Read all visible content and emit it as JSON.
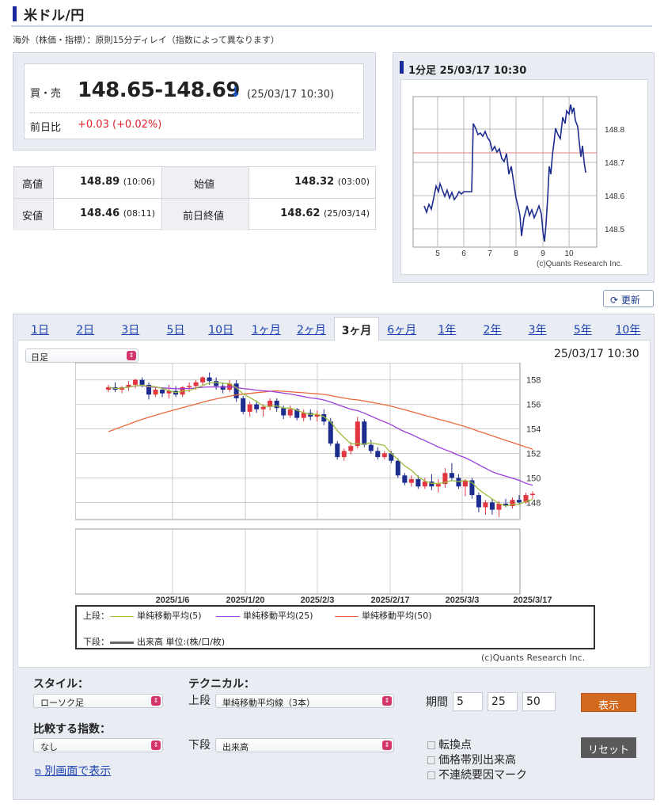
{
  "header": {
    "title": "米ドル/円",
    "note": "海外（株価・指標）：原則15分ディレイ（指数によって異なります）"
  },
  "quote": {
    "bid_ask_label": "買・売",
    "price": "148.65-148.69",
    "direction_arrow": "↓",
    "time": "(25/03/17 10:30)",
    "change_label": "前日比",
    "change": "+0.03 (+0.02%)",
    "change_color": "#e0202a"
  },
  "ohlc": {
    "high_label": "高値",
    "high_value": "148.89",
    "high_time": "(10:06)",
    "open_label": "始値",
    "open_value": "148.32",
    "open_time": "(03:00)",
    "low_label": "安値",
    "low_value": "148.46",
    "low_time": "(08:11)",
    "prev_label": "前日終値",
    "prev_value": "148.62",
    "prev_time": "(25/03/14)"
  },
  "minute_chart": {
    "title": "1分足 25/03/17 10:30",
    "credit": "(c)Quants Research Inc.",
    "x_ticks": [
      "5",
      "6",
      "7",
      "8",
      "9",
      "10"
    ],
    "y_ticks": [
      "148.8",
      "148.7",
      "148.6",
      "148.5"
    ],
    "reference_line": 148.72
  },
  "refresh_label": "更新",
  "tabs": [
    "1日",
    "2日",
    "3日",
    "5日",
    "10日",
    "1ヶ月",
    "2ヶ月",
    "3ヶ月",
    "6ヶ月",
    "1年",
    "2年",
    "3年",
    "5年",
    "10年"
  ],
  "active_tab": "3ヶ月",
  "chart_controls": {
    "period_select": "日足",
    "timestamp": "25/03/17 10:30"
  },
  "chart_data": {
    "type": "candlestick",
    "x_ticks": [
      "2025/1/6",
      "2025/1/20",
      "2025/2/3",
      "2025/2/17",
      "2025/3/3",
      "2025/3/17"
    ],
    "y_ticks": [
      "158",
      "156",
      "154",
      "152",
      "150",
      "148"
    ],
    "ylim": [
      146.6,
      159.4
    ],
    "candles": [
      [
        157.2,
        157.6,
        157.0,
        157.4
      ],
      [
        157.4,
        157.8,
        157.0,
        157.2
      ],
      [
        157.2,
        157.5,
        156.9,
        157.4
      ],
      [
        157.4,
        157.9,
        157.1,
        157.6
      ],
      [
        157.6,
        158.1,
        157.3,
        158.0
      ],
      [
        158.0,
        158.2,
        157.4,
        157.6
      ],
      [
        157.6,
        157.8,
        156.4,
        156.8
      ],
      [
        156.8,
        157.4,
        156.6,
        157.2
      ],
      [
        157.2,
        157.4,
        156.6,
        156.9
      ],
      [
        156.9,
        157.6,
        156.5,
        157.1
      ],
      [
        157.1,
        157.5,
        156.6,
        156.8
      ],
      [
        156.8,
        157.5,
        156.6,
        157.4
      ],
      [
        157.4,
        157.8,
        157.0,
        157.5
      ],
      [
        157.5,
        158.0,
        157.2,
        157.8
      ],
      [
        157.8,
        158.3,
        157.5,
        158.2
      ],
      [
        158.2,
        158.6,
        157.6,
        157.9
      ],
      [
        157.9,
        158.2,
        157.2,
        157.5
      ],
      [
        157.5,
        157.8,
        156.9,
        157.2
      ],
      [
        157.2,
        158.0,
        157.0,
        157.7
      ],
      [
        157.7,
        158.0,
        156.2,
        156.5
      ],
      [
        156.5,
        156.7,
        155.2,
        155.4
      ],
      [
        155.4,
        156.2,
        155.0,
        156.0
      ],
      [
        156.0,
        156.3,
        155.3,
        155.6
      ],
      [
        155.6,
        156.0,
        155.0,
        155.8
      ],
      [
        155.8,
        156.5,
        155.5,
        156.3
      ],
      [
        156.3,
        156.5,
        155.4,
        155.7
      ],
      [
        155.7,
        155.9,
        154.8,
        155.1
      ],
      [
        155.1,
        155.9,
        154.9,
        155.6
      ],
      [
        155.6,
        155.7,
        154.7,
        154.9
      ],
      [
        154.9,
        155.6,
        154.6,
        155.3
      ],
      [
        155.3,
        155.6,
        154.7,
        155.0
      ],
      [
        155.0,
        155.5,
        154.6,
        155.2
      ],
      [
        155.2,
        155.6,
        154.3,
        154.6
      ],
      [
        154.6,
        154.9,
        152.6,
        152.8
      ],
      [
        152.8,
        153.0,
        151.5,
        151.7
      ],
      [
        151.7,
        152.4,
        151.4,
        152.2
      ],
      [
        152.2,
        152.9,
        151.9,
        152.6
      ],
      [
        152.6,
        155.0,
        152.4,
        154.6
      ],
      [
        154.6,
        154.8,
        152.5,
        152.7
      ],
      [
        152.7,
        153.1,
        152.0,
        152.2
      ],
      [
        152.2,
        152.5,
        151.5,
        151.7
      ],
      [
        151.7,
        152.2,
        151.5,
        152.0
      ],
      [
        152.0,
        152.2,
        151.2,
        151.4
      ],
      [
        151.4,
        151.6,
        150.0,
        150.2
      ],
      [
        150.2,
        150.4,
        149.4,
        149.6
      ],
      [
        149.6,
        150.2,
        149.3,
        149.9
      ],
      [
        149.9,
        150.2,
        149.1,
        149.3
      ],
      [
        149.3,
        150.0,
        149.1,
        149.7
      ],
      [
        149.7,
        150.3,
        149.0,
        149.3
      ],
      [
        149.3,
        149.9,
        148.8,
        149.5
      ],
      [
        149.5,
        150.8,
        149.2,
        150.4
      ],
      [
        150.4,
        151.2,
        149.8,
        150.0
      ],
      [
        150.0,
        150.3,
        149.1,
        149.3
      ],
      [
        149.3,
        149.9,
        148.5,
        149.8
      ],
      [
        149.8,
        150.0,
        148.3,
        148.6
      ],
      [
        148.6,
        148.8,
        147.2,
        147.6
      ],
      [
        147.6,
        148.2,
        147.0,
        148.0
      ],
      [
        148.0,
        148.3,
        147.0,
        147.4
      ],
      [
        147.4,
        148.1,
        146.8,
        147.9
      ],
      [
        147.9,
        148.3,
        147.6,
        147.7
      ],
      [
        147.7,
        148.4,
        147.5,
        148.2
      ],
      [
        148.2,
        148.6,
        147.8,
        148.0
      ],
      [
        148.0,
        148.8,
        147.9,
        148.6
      ],
      [
        148.6,
        148.9,
        148.3,
        148.7
      ]
    ],
    "legend_upper_label": "上段：",
    "legend_lower_label": "下段：",
    "series": [
      {
        "name": "単純移動平均(5)",
        "color": "#9bbd3c"
      },
      {
        "name": "単純移動平均(25)",
        "color": "#9a3ddb"
      },
      {
        "name": "単純移動平均(50)",
        "color": "#e86a3a"
      },
      {
        "name": "出来高 単位:(株/口/枚)",
        "color": "#666666"
      }
    ],
    "up_color": "#e2353f",
    "down_color": "#1d2d8f",
    "credit": "(c)Quants Research Inc."
  },
  "controls": {
    "style_label": "スタイル：",
    "style_value": "ローソク足",
    "technical_label": "テクニカル：",
    "upper_label": "上段",
    "upper_value": "単純移動平均線（3本）",
    "period_label": "期間",
    "periods": [
      "5",
      "25",
      "50"
    ],
    "show_button": "表示",
    "compare_label": "比較する指数：",
    "compare_value": "なし",
    "lower_label": "下段",
    "lower_value": "出来高",
    "checkboxes": [
      "転換点",
      "価格帯別出来高",
      "不連続要因マーク"
    ],
    "reset_button": "リセット",
    "popup_link": "別画面で表示"
  }
}
